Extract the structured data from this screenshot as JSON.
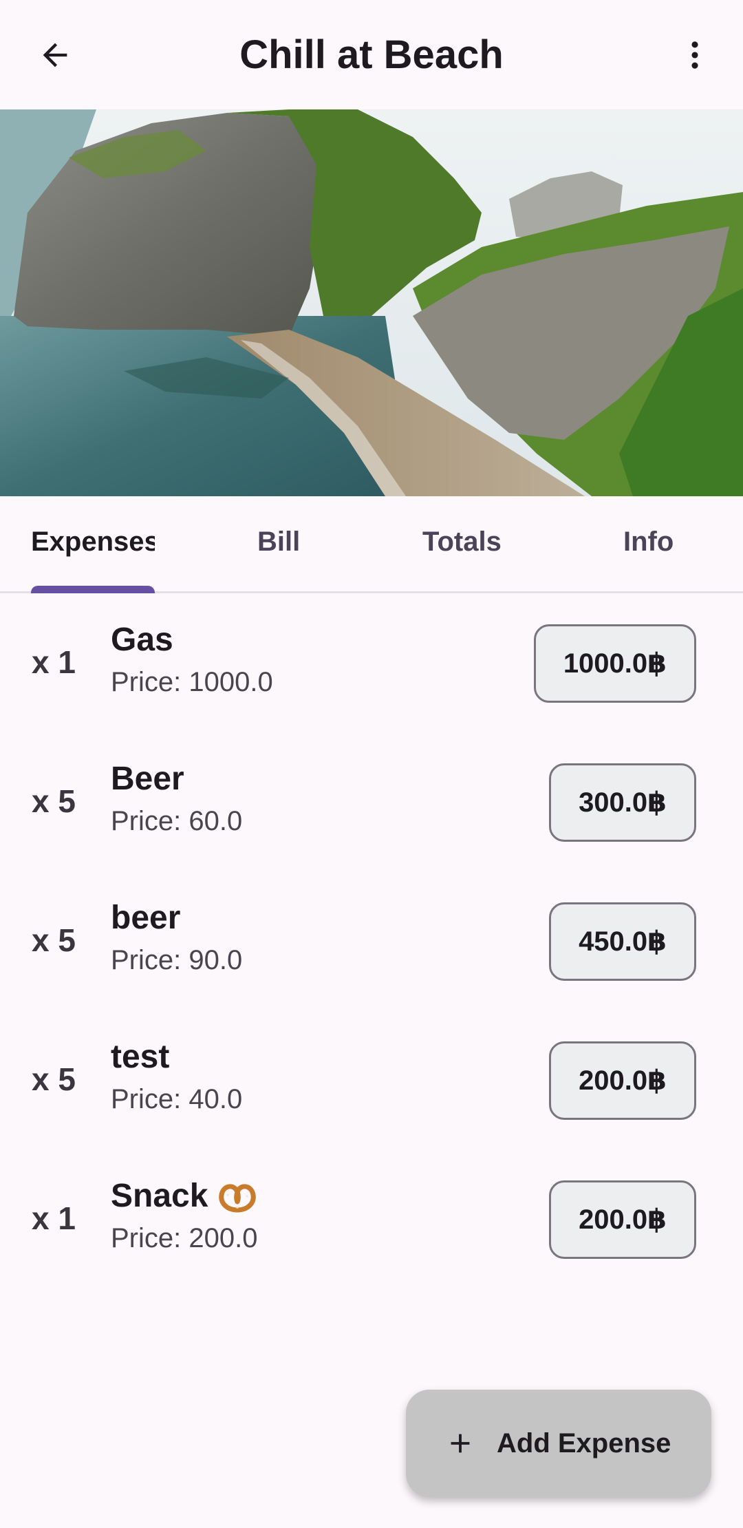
{
  "appbar": {
    "title": "Chill at Beach",
    "back_icon": "arrow-back-icon",
    "menu_icon": "more-vert-icon"
  },
  "cover": {
    "alt": "beach-cove-photo"
  },
  "tabs": [
    {
      "label": "Expenses",
      "active": true
    },
    {
      "label": "Bill",
      "active": false
    },
    {
      "label": "Totals",
      "active": false
    },
    {
      "label": "Info",
      "active": false
    }
  ],
  "expenses": [
    {
      "qty": "x 1",
      "name": "Gas",
      "price": "Price: 1000.0",
      "amount": "1000.0฿"
    },
    {
      "qty": "x 5",
      "name": "Beer",
      "price": "Price: 60.0",
      "amount": "300.0฿"
    },
    {
      "qty": "x 5",
      "name": "beer",
      "price": "Price: 90.0",
      "amount": "450.0฿"
    },
    {
      "qty": "x 5",
      "name": "test",
      "price": "Price: 40.0",
      "amount": "200.0฿"
    },
    {
      "qty": "x 1",
      "name": "Snack",
      "price": "Price: 200.0",
      "amount": "200.0฿"
    }
  ],
  "fab": {
    "label": "Add Expense",
    "icon": "plus-icon"
  },
  "colors": {
    "accent": "#6750a4",
    "background": "#fdf8fc",
    "fab": "#c4c4c4"
  }
}
